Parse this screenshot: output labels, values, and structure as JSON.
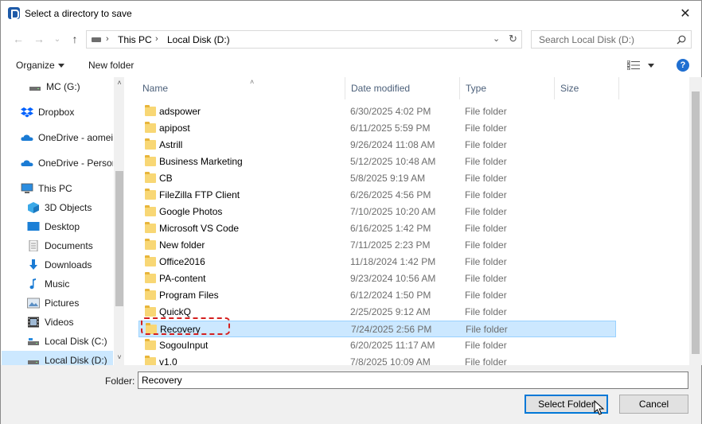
{
  "titlebar": {
    "title": "Select a directory to save",
    "close_glyph": "✕"
  },
  "nav": {
    "back_glyph": "←",
    "forward_glyph": "→",
    "recent_glyph": "⌄",
    "up_glyph": "↑",
    "breadcrumb": [
      "This PC",
      "Local Disk (D:)"
    ],
    "breadcrumb_sep": "›",
    "dropdown_glyph": "⌄",
    "refresh_glyph": "↻"
  },
  "search": {
    "placeholder": "Search Local Disk (D:)"
  },
  "toolbar": {
    "organize_label": "Organize",
    "new_folder_label": "New folder",
    "help_glyph": "?"
  },
  "sidebar": {
    "items": [
      {
        "label": "MC (G:)",
        "icon": "drive-icon"
      },
      {
        "label": "Dropbox",
        "icon": "dropbox-icon"
      },
      {
        "label": "OneDrive - aomei",
        "icon": "cloud-icon"
      },
      {
        "label": "OneDrive - Person",
        "icon": "cloud-icon"
      },
      {
        "label": "This PC",
        "icon": "computer-icon"
      },
      {
        "label": "3D Objects",
        "icon": "cube-icon"
      },
      {
        "label": "Desktop",
        "icon": "desktop-icon"
      },
      {
        "label": "Documents",
        "icon": "documents-icon"
      },
      {
        "label": "Downloads",
        "icon": "download-icon"
      },
      {
        "label": "Music",
        "icon": "music-icon"
      },
      {
        "label": "Pictures",
        "icon": "pictures-icon"
      },
      {
        "label": "Videos",
        "icon": "videos-icon"
      },
      {
        "label": "Local Disk (C:)",
        "icon": "drive-icon"
      },
      {
        "label": "Local Disk (D:)",
        "icon": "drive-icon"
      }
    ],
    "scroll_up_glyph": "˄",
    "scroll_down_glyph": "˅"
  },
  "filelist": {
    "columns": {
      "name": "Name",
      "date": "Date modified",
      "type": "Type",
      "size": "Size"
    },
    "sort_glyph": "˄",
    "rows": [
      {
        "name": "adspower",
        "date": "6/30/2025 4:02 PM",
        "type": "File folder"
      },
      {
        "name": "apipost",
        "date": "6/11/2025 5:59 PM",
        "type": "File folder"
      },
      {
        "name": "Astrill",
        "date": "9/26/2024 11:08 AM",
        "type": "File folder"
      },
      {
        "name": "Business Marketing",
        "date": "5/12/2025 10:48 AM",
        "type": "File folder"
      },
      {
        "name": "CB",
        "date": "5/8/2025 9:19 AM",
        "type": "File folder"
      },
      {
        "name": "FileZilla FTP Client",
        "date": "6/26/2025 4:56 PM",
        "type": "File folder"
      },
      {
        "name": "Google Photos",
        "date": "7/10/2025 10:20 AM",
        "type": "File folder"
      },
      {
        "name": "Microsoft VS Code",
        "date": "6/16/2025 1:42 PM",
        "type": "File folder"
      },
      {
        "name": "New folder",
        "date": "7/11/2025 2:23 PM",
        "type": "File folder"
      },
      {
        "name": "Office2016",
        "date": "11/18/2024 1:42 PM",
        "type": "File folder"
      },
      {
        "name": "PA-content",
        "date": "9/23/2024 10:56 AM",
        "type": "File folder"
      },
      {
        "name": "Program Files",
        "date": "6/12/2024 1:50 PM",
        "type": "File folder"
      },
      {
        "name": "QuickQ",
        "date": "2/25/2025 9:12 AM",
        "type": "File folder"
      },
      {
        "name": "Recovery",
        "date": "7/24/2025 2:56 PM",
        "type": "File folder"
      },
      {
        "name": "SogouInput",
        "date": "6/20/2025 11:17 AM",
        "type": "File folder"
      },
      {
        "name": "v1.0",
        "date": "7/8/2025 10:09 AM",
        "type": "File folder"
      }
    ],
    "selected_index": 13
  },
  "bottom": {
    "folder_label": "Folder:",
    "folder_value": "Recovery",
    "select_label": "Select Folder",
    "cancel_label": "Cancel"
  },
  "colors": {
    "selection": "#cce8ff",
    "accent": "#0078d7",
    "highlight_dash": "#d42020"
  }
}
